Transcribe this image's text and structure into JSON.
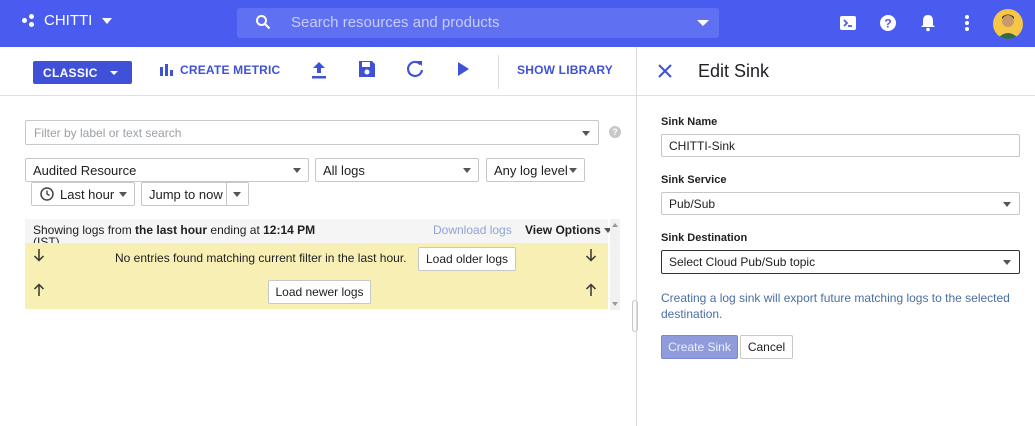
{
  "topbar": {
    "project": "CHITTI",
    "search_placeholder": "Search resources and products",
    "bg_color": "#4a5cf0"
  },
  "toolbar": {
    "classic": "CLASSIC",
    "create_metric": "CREATE METRIC",
    "show_library": "SHOW LIBRARY",
    "icons": [
      "bar-chart-icon",
      "upload-icon",
      "save-icon",
      "refresh-icon",
      "play-icon"
    ]
  },
  "filters": {
    "placeholder": "Filter by label or text search",
    "resource": "Audited Resource",
    "logs": "All logs",
    "level": "Any log level",
    "time": "Last hour",
    "jump": "Jump to now"
  },
  "logs": {
    "showing_prefix": "Showing logs from ",
    "showing_bold1": "the last hour",
    "showing_mid": " ending at ",
    "showing_bold2": "12:14 PM",
    "tz": "(IST)",
    "download": "Download logs",
    "view_options": "View Options",
    "no_entries": "No entries found matching current filter in the last hour.",
    "load_older": "Load older logs",
    "load_newer": "Load newer logs"
  },
  "sink": {
    "title": "Edit Sink",
    "name_label": "Sink Name",
    "name_value": "CHITTI-Sink",
    "service_label": "Sink Service",
    "service_value": "Pub/Sub",
    "dest_label": "Sink Destination",
    "dest_value": "Select Cloud Pub/Sub topic",
    "note": "Creating a log sink will export future matching logs to the selected destination.",
    "create": "Create Sink",
    "cancel": "Cancel"
  }
}
